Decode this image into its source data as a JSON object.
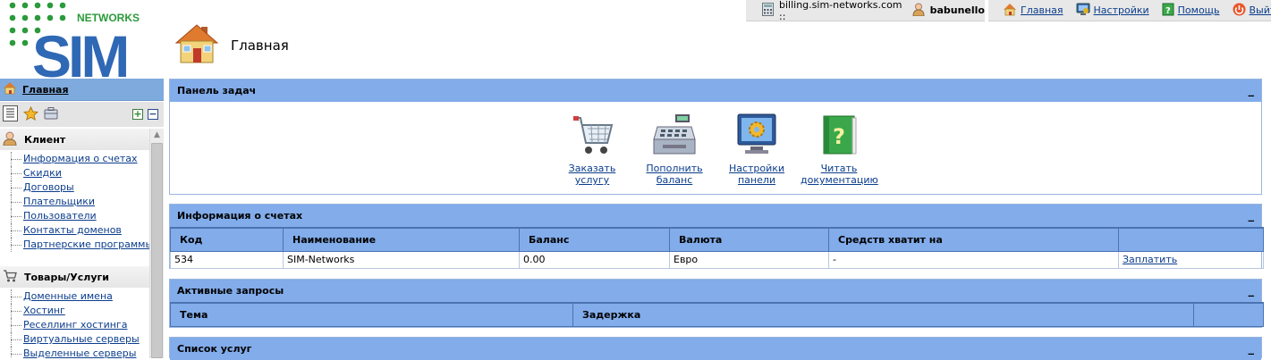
{
  "logo": {
    "text": "SIM",
    "tag": "NETWORKS",
    "dot_color": "#2a9a3a",
    "text_color": "#2f68b4"
  },
  "page": {
    "title": "Главная",
    "icon": "house-icon"
  },
  "account": {
    "host": "billing.sim-networks.com ::",
    "user": "babunello"
  },
  "top_nav": [
    {
      "label": "Главная",
      "icon": "home-icon"
    },
    {
      "label": "Настройки",
      "icon": "settings-icon"
    },
    {
      "label": "Помощь",
      "icon": "help-icon"
    },
    {
      "label": "Выйти",
      "icon": "logout-icon"
    }
  ],
  "sidebar": {
    "home_label": "Главная",
    "groups": [
      {
        "title": "Клиент",
        "icon": "client-icon",
        "items": [
          "Информация о счетах",
          "Скидки",
          "Договоры",
          "Плательщики",
          "Пользователи",
          "Контакты доменов",
          "Партнерские программы"
        ]
      },
      {
        "title": "Товары/Услуги",
        "icon": "cart-icon",
        "items": [
          "Доменные имена",
          "Хостинг",
          "Реселлинг хостинга",
          "Виртуальные серверы",
          "Выделенные серверы"
        ]
      }
    ]
  },
  "tasks_panel": {
    "title": "Панель задач",
    "collapse": "_",
    "items": [
      {
        "line1": "Заказать",
        "line2": "услугу"
      },
      {
        "line1": "Пополнить",
        "line2": "баланс"
      },
      {
        "line1": "Настройки",
        "line2": "панели"
      },
      {
        "line1": "Читать",
        "line2": "документацию"
      }
    ]
  },
  "accounts_panel": {
    "title": "Информация о счетах",
    "collapse": "_",
    "columns": [
      "Код",
      "Наименование",
      "Баланс",
      "Валюта",
      "Средств хватит на",
      ""
    ],
    "rows": [
      {
        "code": "534",
        "name": "SIM-Networks",
        "balance": "0.00",
        "currency": "Евро",
        "enough_for": "-",
        "action": "Заплатить"
      }
    ]
  },
  "requests_panel": {
    "title": "Активные запросы",
    "collapse": "_",
    "columns": [
      "Тема",
      "Задержка",
      ""
    ]
  },
  "services_panel": {
    "title": "Список услуг",
    "collapse": "_"
  },
  "colors": {
    "panel_header": "#82acea",
    "link": "#0b3d8c",
    "sidebar_home": "#7faadd"
  }
}
